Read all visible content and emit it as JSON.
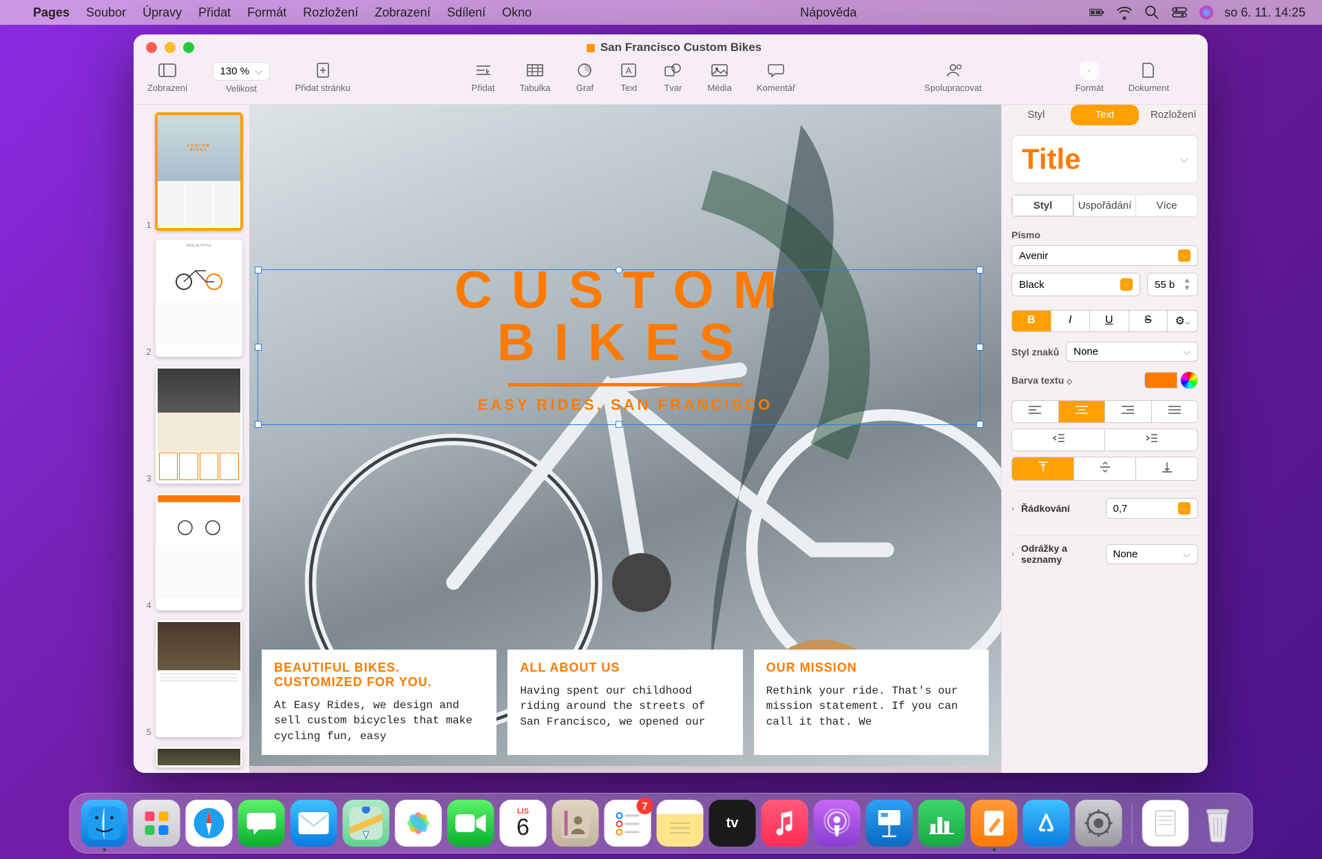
{
  "menubar": {
    "app_name": "Pages",
    "items": [
      "Soubor",
      "Úpravy",
      "Přidat",
      "Formát",
      "Rozložení",
      "Zobrazení",
      "Sdílení",
      "Okno"
    ],
    "help": "Nápověda",
    "clock": "so 6. 11.  14:25"
  },
  "window": {
    "title": "San Francisco Custom Bikes"
  },
  "toolbar": {
    "view": "Zobrazení",
    "zoom_value": "130 %",
    "zoom_label": "Velikost",
    "add_page": "Přidat stránku",
    "insert": "Přidat",
    "table": "Tabulka",
    "chart": "Graf",
    "text": "Text",
    "shape": "Tvar",
    "media": "Média",
    "comment": "Komentář",
    "collaborate": "Spolupracovat",
    "format": "Formát",
    "document": "Dokument"
  },
  "thumbs": {
    "pages": [
      "1",
      "2",
      "3",
      "4",
      "5"
    ]
  },
  "hero": {
    "line1": "CUSTOM",
    "line2": "BIKES",
    "sub": "EASY RIDES, SAN FRANCISCO"
  },
  "cols": {
    "c1_title1": "BEAUTIFUL BIKES.",
    "c1_title2": "CUSTOMIZED FOR YOU.",
    "c1_body": "At Easy Rides, we design and sell custom bicycles that make cycling fun, easy",
    "c2_title": "ALL ABOUT US",
    "c2_body": "Having spent our childhood riding around the streets of San Francisco, we opened our",
    "c3_title": "OUR MISSION",
    "c3_body": "Rethink your ride. That's our mission statement. If you can call it that. We"
  },
  "inspector": {
    "tabs": {
      "style": "Styl",
      "text": "Text",
      "arrange": "Rozložení"
    },
    "title_style": "Title",
    "subtabs": {
      "style": "Styl",
      "layout": "Uspořádání",
      "more": "Více"
    },
    "font_section": "Písmo",
    "font_family": "Avenir",
    "font_weight": "Black",
    "font_size": "55 b",
    "char_style_label": "Styl znaků",
    "char_style_value": "None",
    "text_color_label": "Barva textu",
    "text_color_value": "#ff7a00",
    "line_spacing_label": "Řádkování",
    "line_spacing_value": "0,7",
    "bullets_label": "Odrážky a seznamy",
    "bullets_value": "None"
  },
  "dock": {
    "badge_calendar": "6",
    "badge_calendar_month": "LIS",
    "badge_reminders": "7"
  }
}
